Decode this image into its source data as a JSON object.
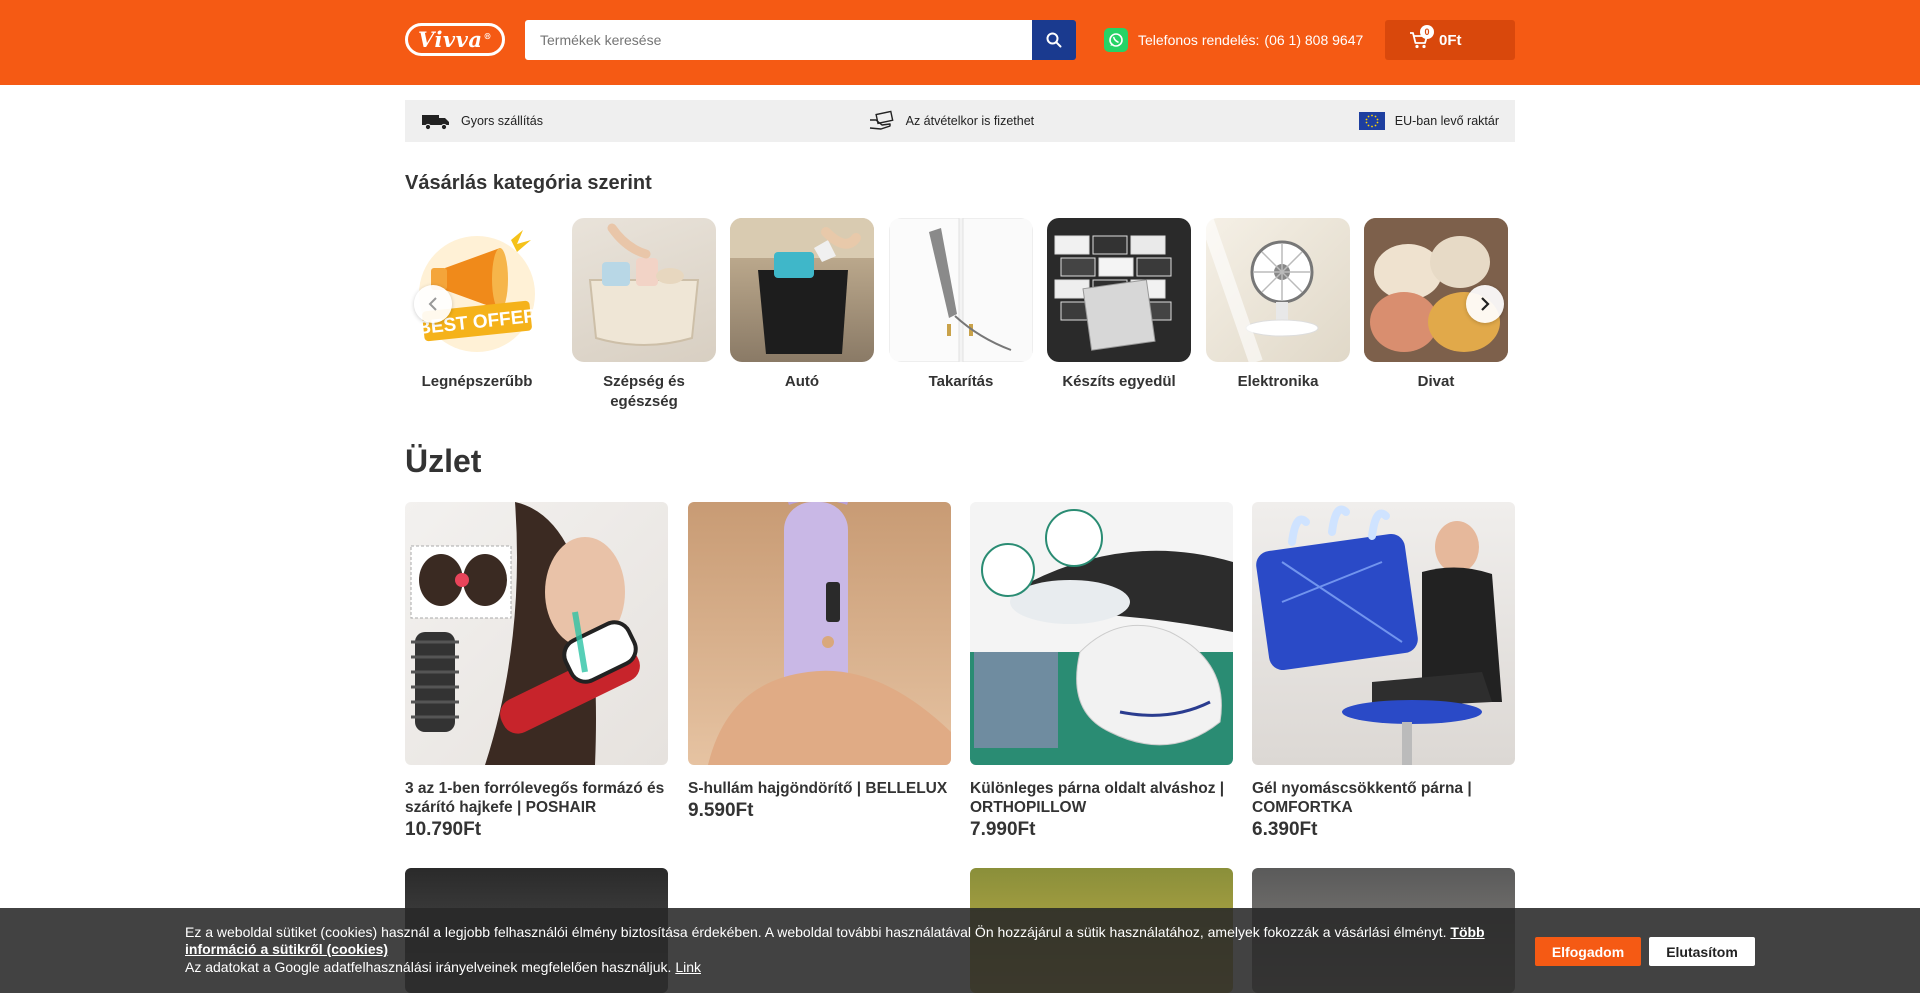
{
  "header": {
    "logo_text": "Vivva",
    "search_placeholder": "Termékek keresése",
    "phone_label": "Telefonos rendelés:",
    "phone_number": "(06 1) 808 9647",
    "cart_count": "0",
    "cart_total": "0Ft",
    "colors": {
      "header_bg": "#f55a14",
      "search_button": "#1a3a8f",
      "cart_bg": "#d9480c"
    }
  },
  "usp": [
    {
      "icon": "truck-icon",
      "label": "Gyors szállítás"
    },
    {
      "icon": "hand-money-icon",
      "label": "Az átvételkor is fizethet"
    },
    {
      "icon": "eu-flag-icon",
      "label": "EU-ban levő raktár"
    }
  ],
  "categories": {
    "title": "Vásárlás kategória szerint",
    "items": [
      {
        "label": "Legnépszerűbb",
        "badge": "BEST OFFER"
      },
      {
        "label": "Szépség és egészség"
      },
      {
        "label": "Autó"
      },
      {
        "label": "Takarítás"
      },
      {
        "label": "Készíts egyedül"
      },
      {
        "label": "Elektronika"
      },
      {
        "label": "Divat"
      }
    ]
  },
  "shop": {
    "title": "Üzlet",
    "products": [
      {
        "name": "3 az 1-ben forrólevegős formázó és szárító hajkefe | POSHAIR",
        "price": "10.790Ft"
      },
      {
        "name": "S-hullám hajgöndörítő | BELLELUX",
        "price": "9.590Ft"
      },
      {
        "name": "Különleges párna oldalt alváshoz | ORTHOPILLOW",
        "price": "7.990Ft"
      },
      {
        "name": "Gél nyomáscsökkentő párna | COMFORTKA",
        "price": "6.390Ft"
      }
    ]
  },
  "cookie": {
    "text": "Ez a weboldal sütiket (cookies) használ a legjobb felhasználói élmény biztosítása érdekében. A weboldal további használatával Ön hozzájárul a sütik használatához, amelyek fokozzák a vásárlási élményt.",
    "more_link": "Több információ a sütikről (cookies)",
    "google_text": "Az adatokat a Google adatfelhasználási irányelveinek megfelelően használjuk.",
    "google_link": "Link",
    "accept": "Elfogadom",
    "reject": "Elutasítom"
  }
}
